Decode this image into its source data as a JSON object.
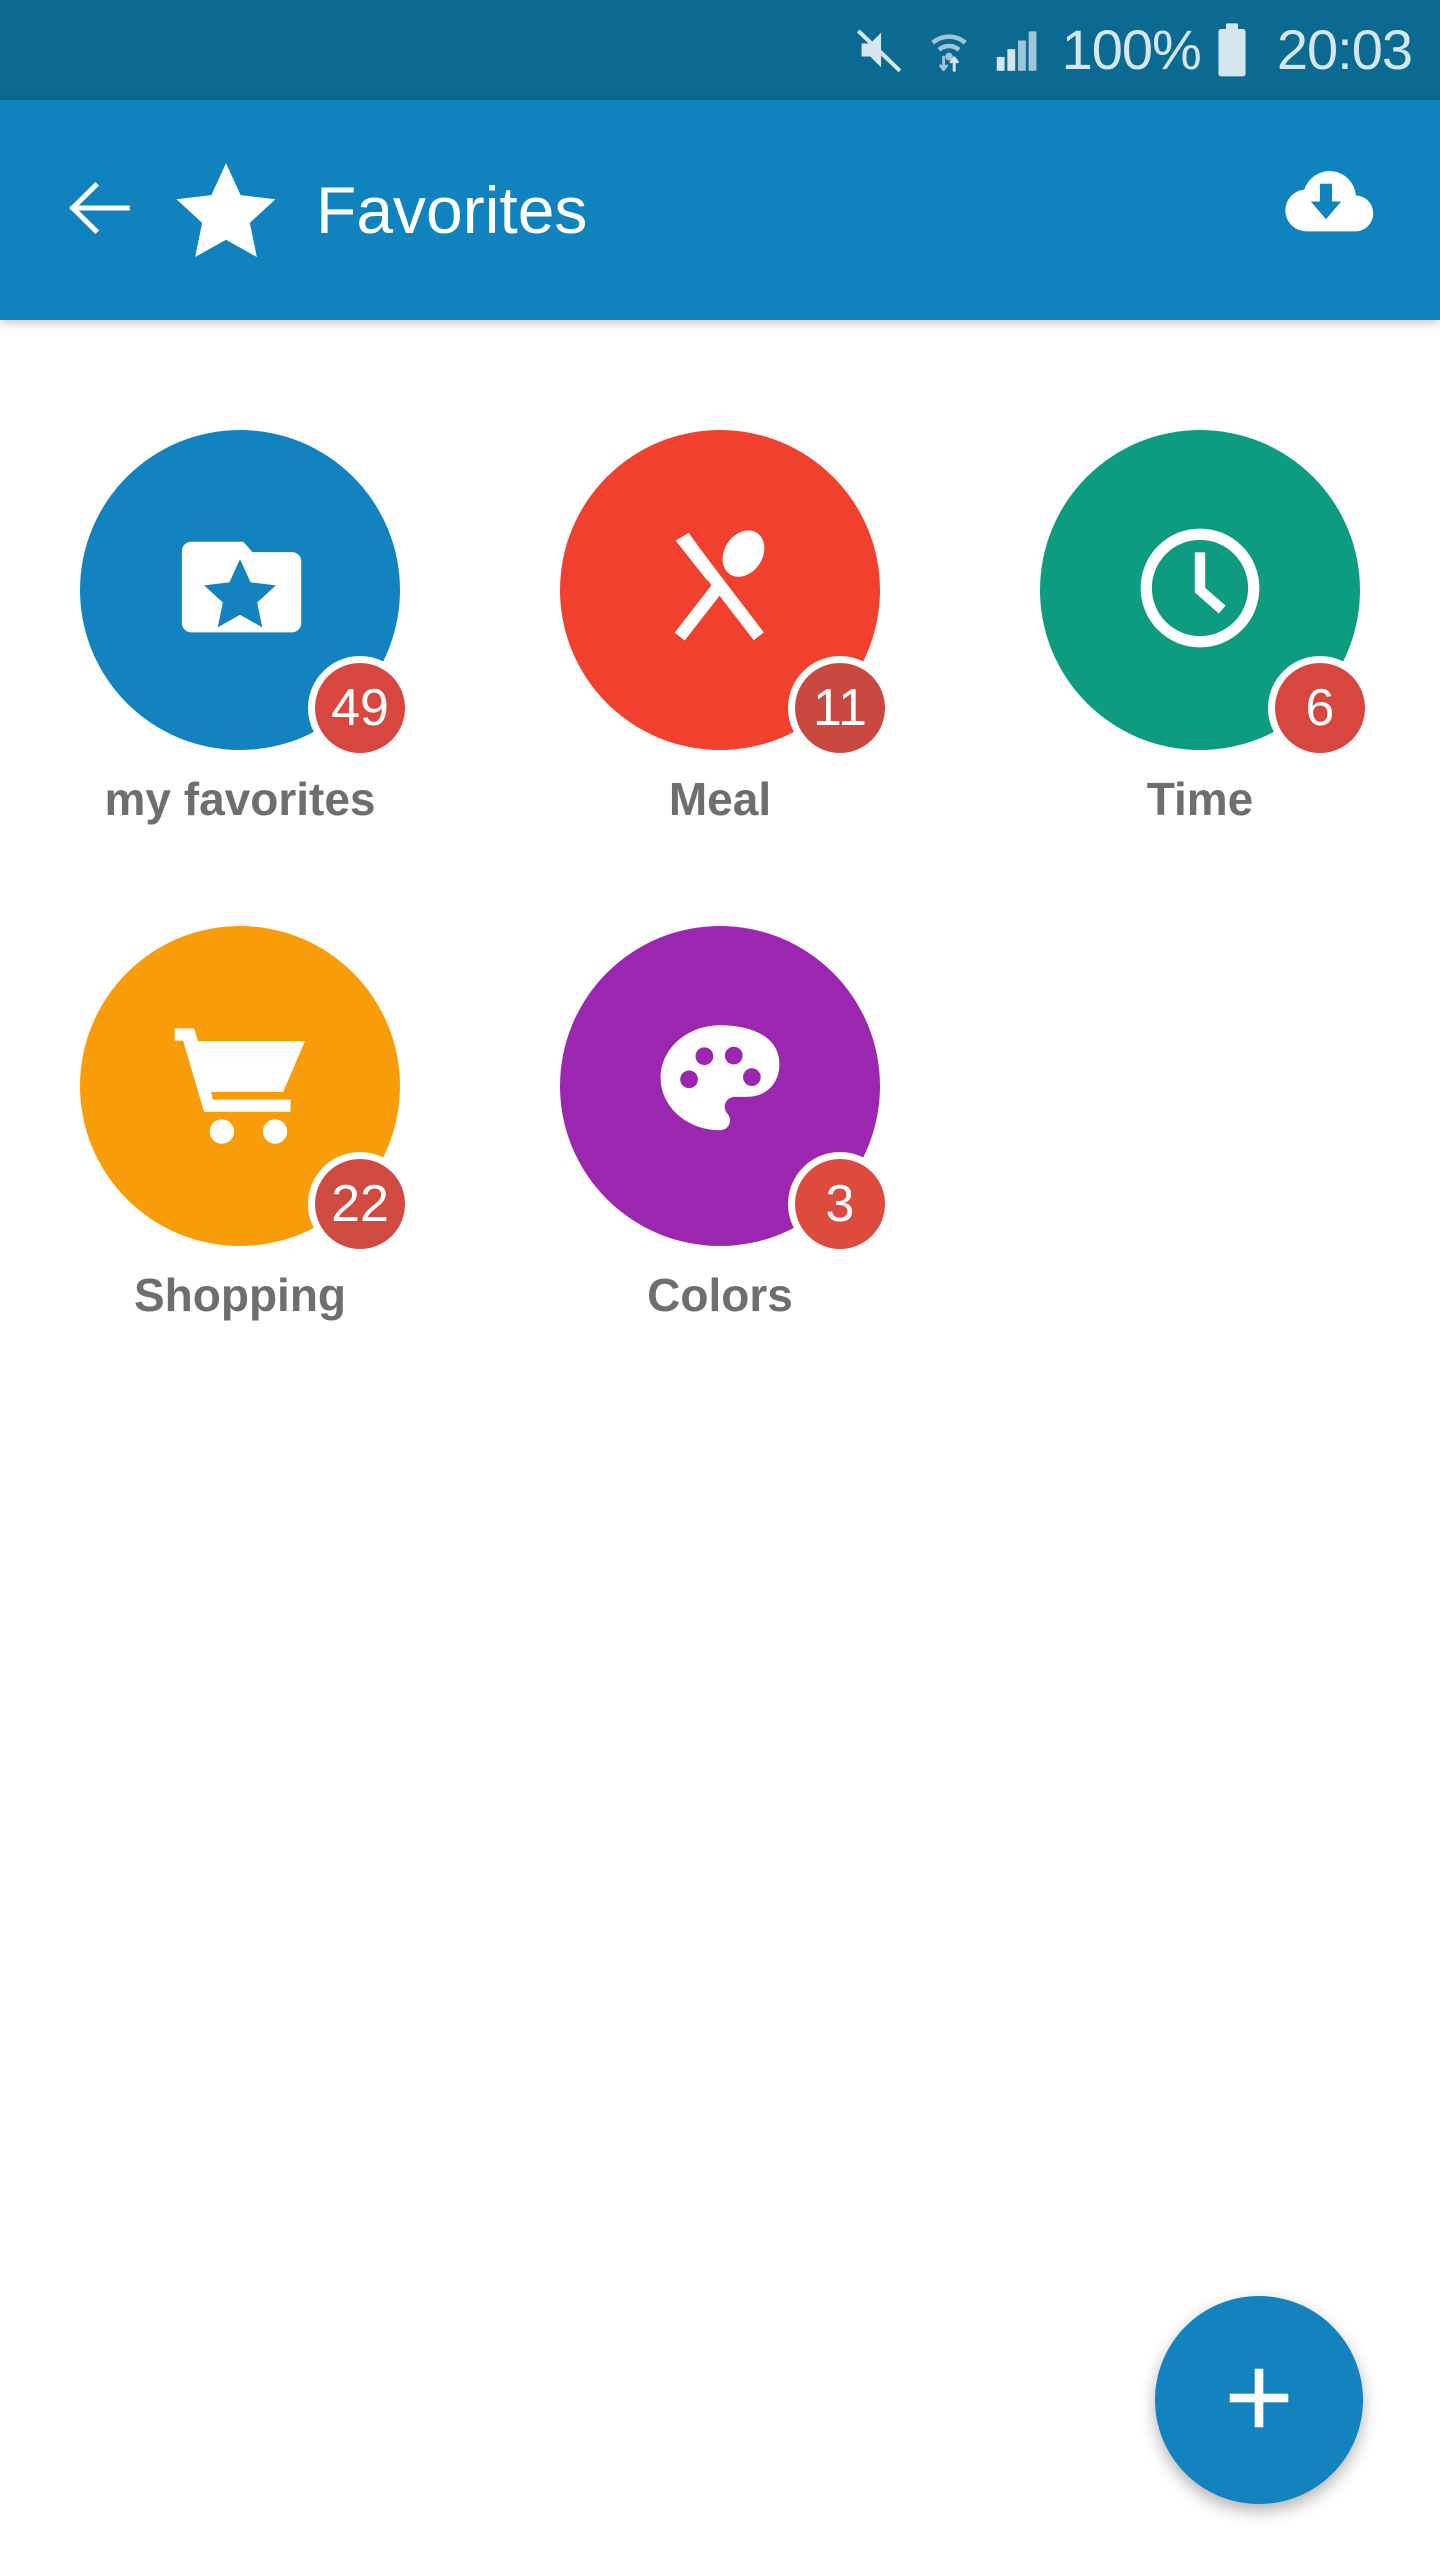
{
  "status_bar": {
    "background": "#0B6A92",
    "icons": [
      "mute-icon",
      "wifi-icon",
      "signal-icon",
      "battery-icon"
    ],
    "battery_percent": "100%",
    "time": "20:03"
  },
  "app_bar": {
    "background": "#1083BE",
    "back_icon": "back-arrow-icon",
    "brand_icon": "star-icon",
    "title": "Favorites",
    "action_icon": "cloud-download-icon"
  },
  "content": {
    "background": "#FFFFFF",
    "tiles": [
      {
        "label": "my favorites",
        "icon": "folder-star-icon",
        "color": "#1283BE",
        "badge": "49",
        "badge_color": "#D8473F"
      },
      {
        "label": "Meal",
        "icon": "fork-spoon-icon",
        "color": "#F2402F",
        "badge": "11",
        "badge_color": "#C9483F"
      },
      {
        "label": "Time",
        "icon": "clock-icon",
        "color": "#0E9C80",
        "badge": "6",
        "badge_color": "#D8473F"
      },
      {
        "label": "Shopping",
        "icon": "shopping-cart-icon",
        "color": "#F99C09",
        "badge": "22",
        "badge_color": "#CF4A40"
      },
      {
        "label": "Colors",
        "icon": "palette-icon",
        "color": "#9B27B0",
        "badge": "3",
        "badge_color": "#DD4B3C"
      }
    ]
  },
  "fab": {
    "icon": "plus-icon",
    "color": "#1283BE",
    "label": "+"
  }
}
